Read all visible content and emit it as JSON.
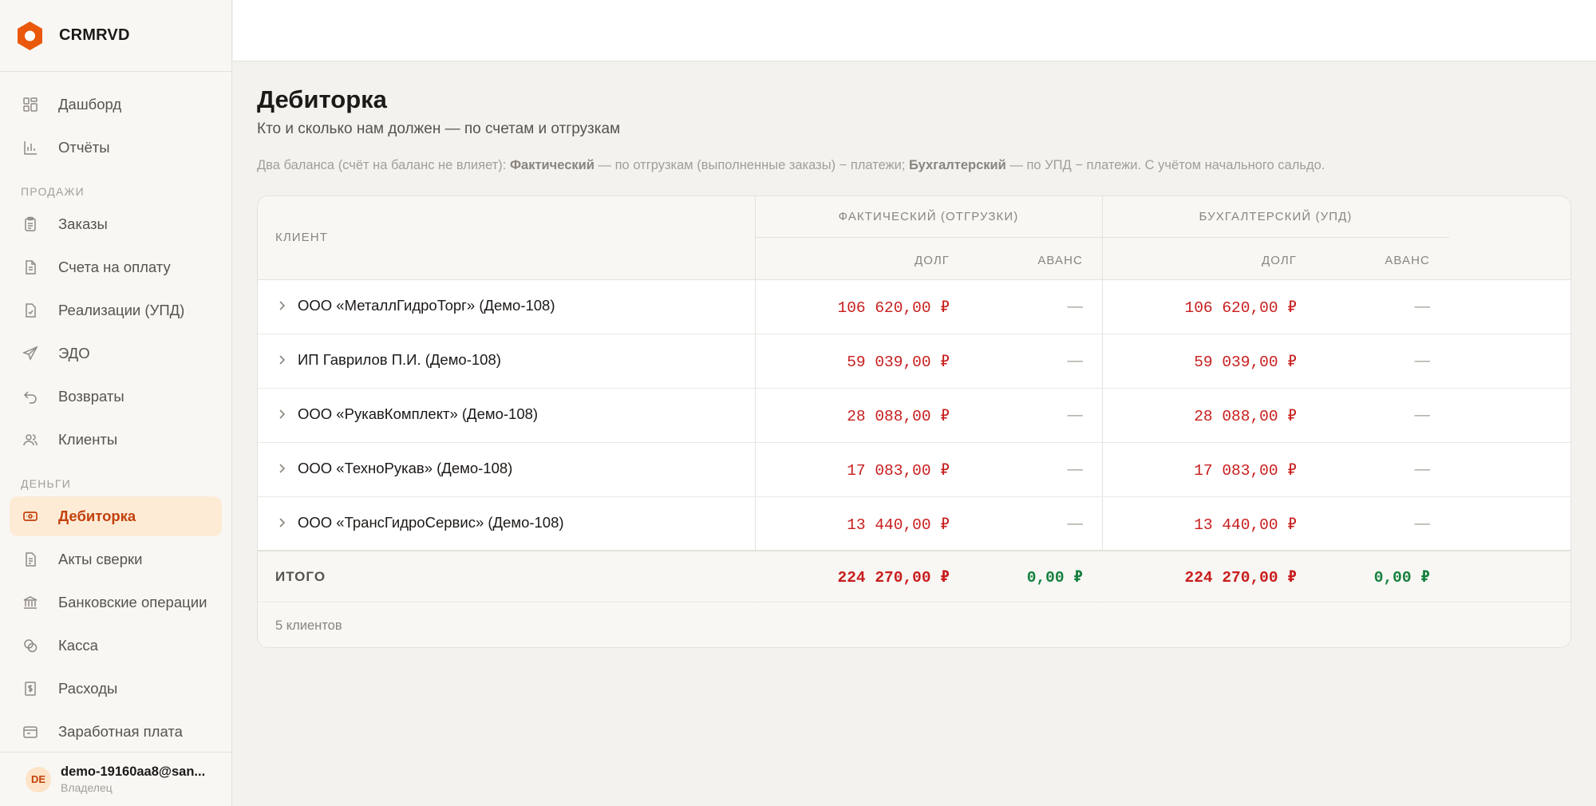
{
  "brand": {
    "name": "CRMRVD",
    "color": "#ea580c"
  },
  "sidebar": {
    "top_items": [
      {
        "label": "Дашборд",
        "icon": "dashboard-icon"
      },
      {
        "label": "Отчёты",
        "icon": "bar-chart-icon"
      }
    ],
    "sales_section": "ПРОДАЖИ",
    "sales_items": [
      {
        "label": "Заказы",
        "icon": "clipboard-icon"
      },
      {
        "label": "Счета на оплату",
        "icon": "invoice-icon"
      },
      {
        "label": "Реализации (УПД)",
        "icon": "document-check-icon"
      },
      {
        "label": "ЭДО",
        "icon": "send-icon"
      },
      {
        "label": "Возвраты",
        "icon": "undo-icon"
      },
      {
        "label": "Клиенты",
        "icon": "users-icon"
      }
    ],
    "money_section": "ДЕНЬГИ",
    "money_items": [
      {
        "label": "Дебиторка",
        "icon": "receivables-icon",
        "active": true
      },
      {
        "label": "Акты сверки",
        "icon": "reconciliation-icon"
      },
      {
        "label": "Банковские операции",
        "icon": "bank-icon"
      },
      {
        "label": "Касса",
        "icon": "coins-icon"
      },
      {
        "label": "Расходы",
        "icon": "receipt-icon"
      },
      {
        "label": "Заработная плата",
        "icon": "payroll-icon"
      }
    ]
  },
  "user": {
    "initials": "DE",
    "email": "demo-19160aa8@sandbox.local",
    "email_display": "demo-19160aa8@san...",
    "role": "Владелец"
  },
  "page": {
    "title": "Дебиторка",
    "subtitle": "Кто и сколько нам должен — по счетам и отгрузкам",
    "note_prefix": "Два баланса (счёт на баланс не влияет): ",
    "note_b1": "Фактический",
    "note_mid": " — по отгрузкам (выполненные заказы) − платежи; ",
    "note_b2": "Бухгалтерский",
    "note_suffix": " — по УПД − платежи. С учётом начального сальдо."
  },
  "table": {
    "col_client": "КЛИЕНТ",
    "group_fact": "ФАКТИЧЕСКИЙ (ОТГРУЗКИ)",
    "group_acc": "БУХГАЛТЕРСКИЙ (УПД)",
    "col_debt": "ДОЛГ",
    "col_advance": "АВАНС",
    "rows": [
      {
        "name": "ООО «МеталлГидроТорг» (Демо-108)",
        "fact_debt": "106 620,00 ₽",
        "fact_adv": "—",
        "acc_debt": "106 620,00 ₽",
        "acc_adv": "—"
      },
      {
        "name": "ИП Гаврилов П.И. (Демо-108)",
        "fact_debt": "59 039,00 ₽",
        "fact_adv": "—",
        "acc_debt": "59 039,00 ₽",
        "acc_adv": "—"
      },
      {
        "name": "ООО «РукавКомплект» (Демо-108)",
        "fact_debt": "28 088,00 ₽",
        "fact_adv": "—",
        "acc_debt": "28 088,00 ₽",
        "acc_adv": "—"
      },
      {
        "name": "ООО «ТехноРукав» (Демо-108)",
        "fact_debt": "17 083,00 ₽",
        "fact_adv": "—",
        "acc_debt": "17 083,00 ₽",
        "acc_adv": "—"
      },
      {
        "name": "ООО «ТрансГидроСервис» (Демо-108)",
        "fact_debt": "13 440,00 ₽",
        "fact_adv": "—",
        "acc_debt": "13 440,00 ₽",
        "acc_adv": "—"
      }
    ],
    "total_label": "ИТОГО",
    "total": {
      "fact_debt": "224 270,00 ₽",
      "fact_adv": "0,00 ₽",
      "acc_debt": "224 270,00 ₽",
      "acc_adv": "0,00 ₽"
    },
    "footer": "5 клиентов"
  },
  "colors": {
    "debt": "#c81e1e",
    "advance": "#15803d",
    "accent": "#c2410c",
    "active_bg": "#fdebd6"
  }
}
